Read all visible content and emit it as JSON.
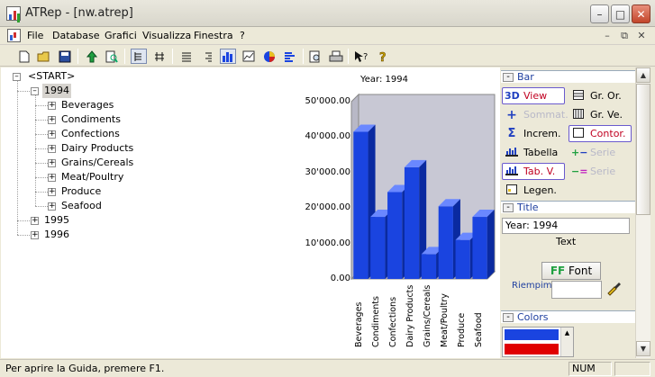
{
  "window": {
    "title": "ATRep - [nw.atrep]"
  },
  "menu": {
    "items": [
      "File",
      "Database",
      "Grafici",
      "Visualizza",
      "Finestra",
      "?"
    ]
  },
  "toolbar": {
    "buttons": [
      "new-icon",
      "open-icon",
      "save-icon",
      "up-arrow-icon",
      "find-icon",
      "tree-left-icon",
      "tree-split-icon",
      "align-left-icon",
      "align-right-icon",
      "bar-chart-icon",
      "line-chart-icon",
      "pie-chart-icon",
      "list-chart-icon",
      "print-preview-icon",
      "print-icon",
      "context-help-icon",
      "help-icon"
    ],
    "pressed": [
      "bar-chart-icon"
    ]
  },
  "tree": {
    "root": "<START>",
    "years": [
      {
        "label": "1994",
        "expanded": true,
        "selected": true,
        "children": [
          "Beverages",
          "Condiments",
          "Confections",
          "Dairy Products",
          "Grains/Cereals",
          "Meat/Poultry",
          "Produce",
          "Seafood"
        ]
      },
      {
        "label": "1995",
        "expanded": false,
        "children": []
      },
      {
        "label": "1996",
        "expanded": false,
        "children": []
      }
    ]
  },
  "chart_data": {
    "type": "bar",
    "title": "Year: 1994",
    "categories": [
      "Beverages",
      "Condiments",
      "Confections",
      "Dairy Products",
      "Grains/Cereals",
      "Meat/Poultry",
      "Produce",
      "Seafood"
    ],
    "values": [
      41500,
      17500,
      24500,
      31500,
      7000,
      20500,
      11000,
      17500
    ],
    "yticks": [
      "0.00",
      "10'000.00",
      "20'000.00",
      "30'000.00",
      "40'000.00",
      "50'000.00"
    ],
    "ylim": [
      0,
      50000
    ],
    "bar_color": "#1a44e0",
    "plot_bg": "#c8c8d4",
    "grid": false,
    "three_d": true
  },
  "panel": {
    "bar_section": "Bar",
    "buttons": {
      "view": "View",
      "gr_or": "Gr. Or.",
      "sommat": "Sommat.",
      "gr_ve": "Gr. Ve.",
      "increm": "Increm.",
      "contor": "Contor.",
      "tabella": "Tabella",
      "serie1": "Serie",
      "tab_v": "Tab. V.",
      "serie2": "Serie",
      "legen": "Legen."
    },
    "title_section": "Title",
    "title_value": "Year: 1994",
    "text_label": "Text",
    "font_button": "Font",
    "riempim_label": "Riempim.",
    "colors_section": "Colors",
    "color_swatches": [
      "#1a44e0",
      "#e00000"
    ]
  },
  "status": {
    "message": "Per aprire la Guida, premere F1.",
    "num": "NUM"
  }
}
